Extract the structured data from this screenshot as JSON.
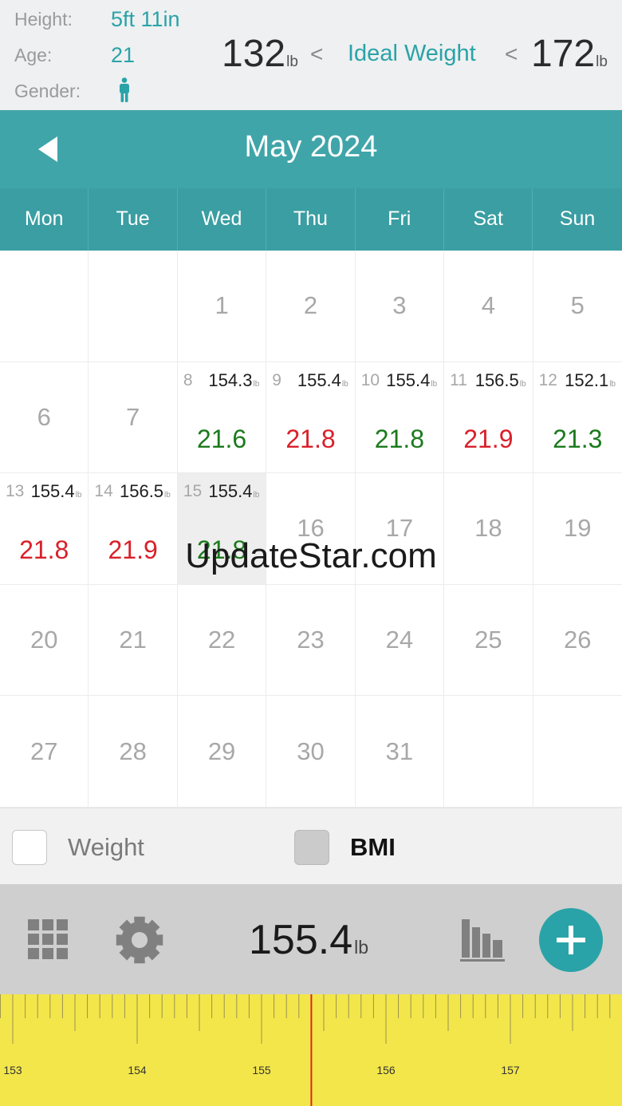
{
  "profile": {
    "height_label": "Height:",
    "height_value": "5ft 11in",
    "age_label": "Age:",
    "age_value": "21",
    "gender_label": "Gender:",
    "gender_icon": "male-person-icon"
  },
  "ideal": {
    "min": "132",
    "max": "172",
    "unit": "lb",
    "lt": "<",
    "label": "Ideal Weight"
  },
  "calendar": {
    "title": "May 2024",
    "weekdays": [
      "Mon",
      "Tue",
      "Wed",
      "Thu",
      "Fri",
      "Sat",
      "Sun"
    ],
    "weight_unit": "lb",
    "cells": [
      {
        "day": ""
      },
      {
        "day": ""
      },
      {
        "day": "1"
      },
      {
        "day": "2"
      },
      {
        "day": "3"
      },
      {
        "day": "4"
      },
      {
        "day": "5"
      },
      {
        "day": "6"
      },
      {
        "day": "7"
      },
      {
        "day": "8",
        "weight": "154.3",
        "bmi": "21.6",
        "status": "good"
      },
      {
        "day": "9",
        "weight": "155.4",
        "bmi": "21.8",
        "status": "bad"
      },
      {
        "day": "10",
        "weight": "155.4",
        "bmi": "21.8",
        "status": "good"
      },
      {
        "day": "11",
        "weight": "156.5",
        "bmi": "21.9",
        "status": "bad"
      },
      {
        "day": "12",
        "weight": "152.1",
        "bmi": "21.3",
        "status": "good"
      },
      {
        "day": "13",
        "weight": "155.4",
        "bmi": "21.8",
        "status": "bad"
      },
      {
        "day": "14",
        "weight": "156.5",
        "bmi": "21.9",
        "status": "bad"
      },
      {
        "day": "15",
        "weight": "155.4",
        "bmi": "21.8",
        "status": "good",
        "today": true
      },
      {
        "day": "16"
      },
      {
        "day": "17"
      },
      {
        "day": "18"
      },
      {
        "day": "19"
      },
      {
        "day": "20"
      },
      {
        "day": "21"
      },
      {
        "day": "22"
      },
      {
        "day": "23"
      },
      {
        "day": "24"
      },
      {
        "day": "25"
      },
      {
        "day": "26"
      },
      {
        "day": "27"
      },
      {
        "day": "28"
      },
      {
        "day": "29"
      },
      {
        "day": "30"
      },
      {
        "day": "31"
      },
      {
        "day": ""
      },
      {
        "day": ""
      }
    ]
  },
  "watermark": "UpdateStar.com",
  "legend": {
    "weight_label": "Weight",
    "weight_checked": false,
    "bmi_label": "BMI",
    "bmi_checked": true
  },
  "toolbar": {
    "current_weight": "155.4",
    "unit": "lb",
    "calendar_icon": "grid-calendar-icon",
    "settings_icon": "gear-icon",
    "chart_icon": "bar-chart-icon",
    "add_icon": "plus-icon"
  },
  "ruler": {
    "labels": [
      "153",
      "154",
      "155",
      "156",
      "157"
    ],
    "current_value": 155.4
  },
  "colors": {
    "teal": "#40a5a9",
    "good": "#1c7a1c",
    "bad": "#d9202a",
    "ruler": "#f3e64a"
  }
}
